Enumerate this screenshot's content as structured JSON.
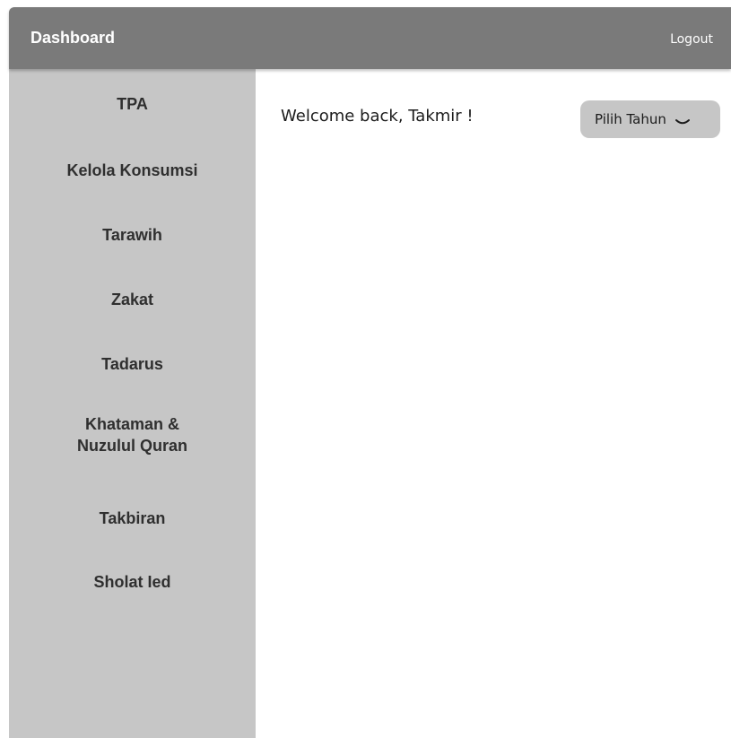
{
  "header": {
    "title": "Dashboard",
    "logout_label": "Logout"
  },
  "sidebar": {
    "items": [
      {
        "label": "TPA"
      },
      {
        "label": "Kelola Konsumsi"
      },
      {
        "label": "Tarawih"
      },
      {
        "label": "Zakat"
      },
      {
        "label": "Tadarus"
      },
      {
        "line1": "Khataman &",
        "line2": "Nuzulul Quran"
      },
      {
        "label": "Takbiran"
      },
      {
        "label": "Sholat Ied"
      }
    ]
  },
  "main": {
    "welcome_text": "Welcome back, Takmir !",
    "year_select": {
      "label": "Pilih Tahun",
      "icon": "chevron-down-icon"
    }
  },
  "colors": {
    "topbar": "#7a7a7a",
    "sidebar": "#c6c6c6",
    "select": "#c6c6c6",
    "text": "#2f2f2f"
  }
}
